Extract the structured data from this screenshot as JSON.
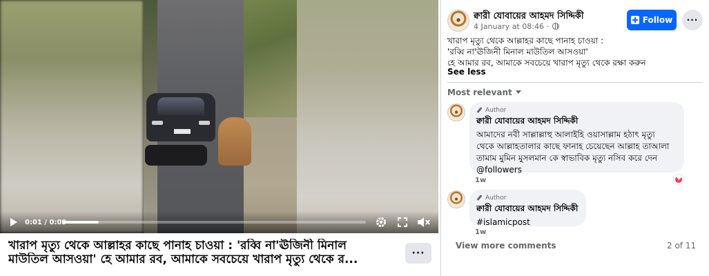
{
  "video": {
    "time_label": "0:01 / 0:09",
    "progress_fraction": 0.12
  },
  "caption": {
    "line1": "খারাপ মৃত্যু থেকে আল্লাহর কাছে পানাহ চাওয়া : 'রব্বি না'ঊজিনী মিনাল",
    "line2": "মাউতিল আসওয়া' হে আমার রব, আমাকে সবচেয়ে খারাপ মৃত্যু থেকে র..."
  },
  "more_button_label": "···",
  "post": {
    "author": "ক্বারী যোবায়ের আহমদ সিদ্দিকী",
    "date": "4 January at 08:46",
    "dot": "·",
    "follow_label": "Follow",
    "menu_label": "···",
    "text_lines": [
      "খারাপ মৃত্যু থেকে আল্লাহর কাছে পানাহ চাওয়া :",
      "'রব্বি না'ঊজিনী মিনাল মাউতিল আসওয়া'",
      "হে আমার রব, আমাকে সবচেয়ে খারাপ মৃত্যু থেকে রক্ষা করুন"
    ],
    "see_less": "See less"
  },
  "comments_sort": "Most relevant",
  "comments": [
    {
      "badge": "Author",
      "name": "ক্বারী যোবায়ের আহমদ সিদ্দিকী",
      "lines": [
        "আমাদের নবী সাল্লাল্লাহু আলাইহি ওয়াসাল্লাম হঠাৎ মৃত্যু",
        "থেকে আল্লাহতালার কাছে ফানাহ চেয়েছেন আল্লাহ তাআলা",
        "তামাম মুমিন মুসলমান কে স্বাভাবিক মৃত্যু নসিব করে দেন",
        "@followers"
      ],
      "age": "1w"
    },
    {
      "badge": "Author",
      "name": "ক্বারী যোবায়ের আহমদ সিদ্দিকী",
      "lines": [
        "#islamicpost"
      ],
      "age": "1w"
    }
  ],
  "view_more_comments": "View more comments",
  "pager": "2 of 11",
  "colors": {
    "accent": "#0866ff",
    "text": "#050505",
    "muted": "#65676b",
    "bubble": "#f0f2f5",
    "reaction": "#f33e58"
  }
}
